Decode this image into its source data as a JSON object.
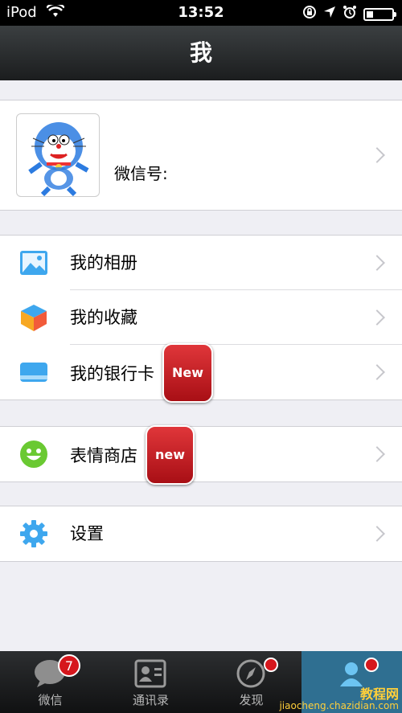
{
  "status_bar": {
    "carrier": "iPod",
    "time": "13:52",
    "battery_level": 0.25
  },
  "nav": {
    "title": "我"
  },
  "profile": {
    "name": "",
    "wechat_id_label": "微信号:"
  },
  "menu_group1": [
    {
      "label": "我的相册",
      "icon": "photo-album-icon",
      "badge": ""
    },
    {
      "label": "我的收藏",
      "icon": "favorites-cube-icon",
      "badge": ""
    },
    {
      "label": "我的银行卡",
      "icon": "bank-card-icon",
      "badge": "New"
    }
  ],
  "menu_group2": [
    {
      "label": "表情商店",
      "icon": "smiley-icon",
      "badge": "new"
    }
  ],
  "menu_group3": [
    {
      "label": "设置",
      "icon": "gear-icon",
      "badge": ""
    }
  ],
  "tabs": [
    {
      "label": "微信",
      "badge": "7",
      "icon": "chat-bubble-icon"
    },
    {
      "label": "通讯录",
      "badge": "",
      "icon": "contacts-card-icon"
    },
    {
      "label": "发现",
      "badge": "dot",
      "icon": "compass-icon"
    },
    {
      "label": "",
      "badge": "dot",
      "icon": "me-icon"
    }
  ],
  "watermark": {
    "line1": "教程网",
    "line2": "jiaocheng.chazidian.com"
  },
  "colors": {
    "nav_bg": "#1b1d1e",
    "badge_red": "#d6171d",
    "accent_blue": "#4eb5f5",
    "active_tab": "#2f6f91"
  }
}
